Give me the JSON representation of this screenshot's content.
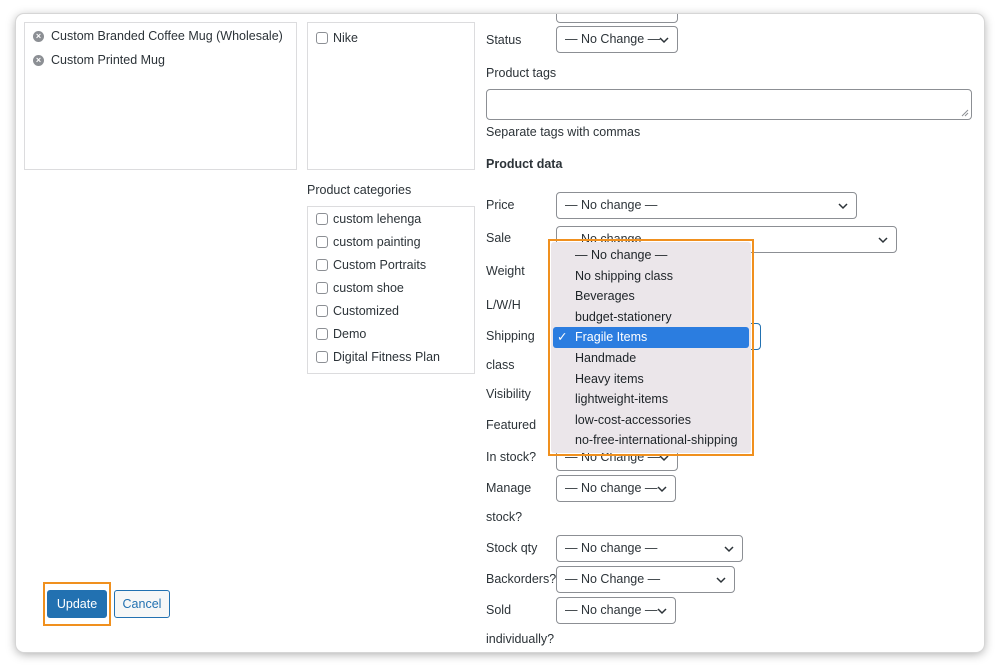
{
  "left_list": {
    "items": [
      "Custom Branded Coffee Mug (Wholesale)",
      "Custom Printed Mug"
    ]
  },
  "brands": {
    "items": [
      "Nike"
    ]
  },
  "categories": {
    "heading": "Product categories",
    "items": [
      "custom lehenga",
      "custom painting",
      "Custom Portraits",
      "custom shoe",
      "Customized",
      "Demo",
      "Digital Fitness Plan"
    ]
  },
  "form": {
    "status_label": "Status",
    "status_value": "— No Change —",
    "tags_label": "Product tags",
    "tags_help": "Separate tags with commas",
    "product_data_heading": "Product data",
    "price_label": "Price",
    "price_value": "— No change —",
    "sale_label": "Sale",
    "sale_value": "— No change —",
    "weight_label": "Weight",
    "lwh_label": "L/W/H",
    "shipping_label_1": "Shipping",
    "shipping_label_2": "class",
    "visibility_label": "Visibility",
    "featured_label": "Featured",
    "instock_label": "In stock?",
    "instock_value": "— No Change —",
    "manage_label_1": "Manage",
    "manage_label_2": "stock?",
    "manage_value": "— No change —",
    "stockqty_label": "Stock qty",
    "stockqty_value": "— No change —",
    "backorders_label": "Backorders?",
    "backorders_value": "— No Change —",
    "sold_label_1": "Sold",
    "sold_label_2": "individually?",
    "sold_value": "— No change —"
  },
  "shipping_dropdown": {
    "options": [
      "— No change —",
      "No shipping class",
      "Beverages",
      "budget-stationery",
      "Fragile Items",
      "Handmade",
      "Heavy items",
      "lightweight-items",
      "low-cost-accessories",
      "no-free-international-shipping"
    ],
    "selected": "Fragile Items",
    "check_glyph": "✓"
  },
  "actions": {
    "update_label": "Update",
    "cancel_label": "Cancel"
  },
  "colors": {
    "highlight": "#f0901e",
    "primary": "#2271b1",
    "selected_option": "#2b7de0"
  }
}
